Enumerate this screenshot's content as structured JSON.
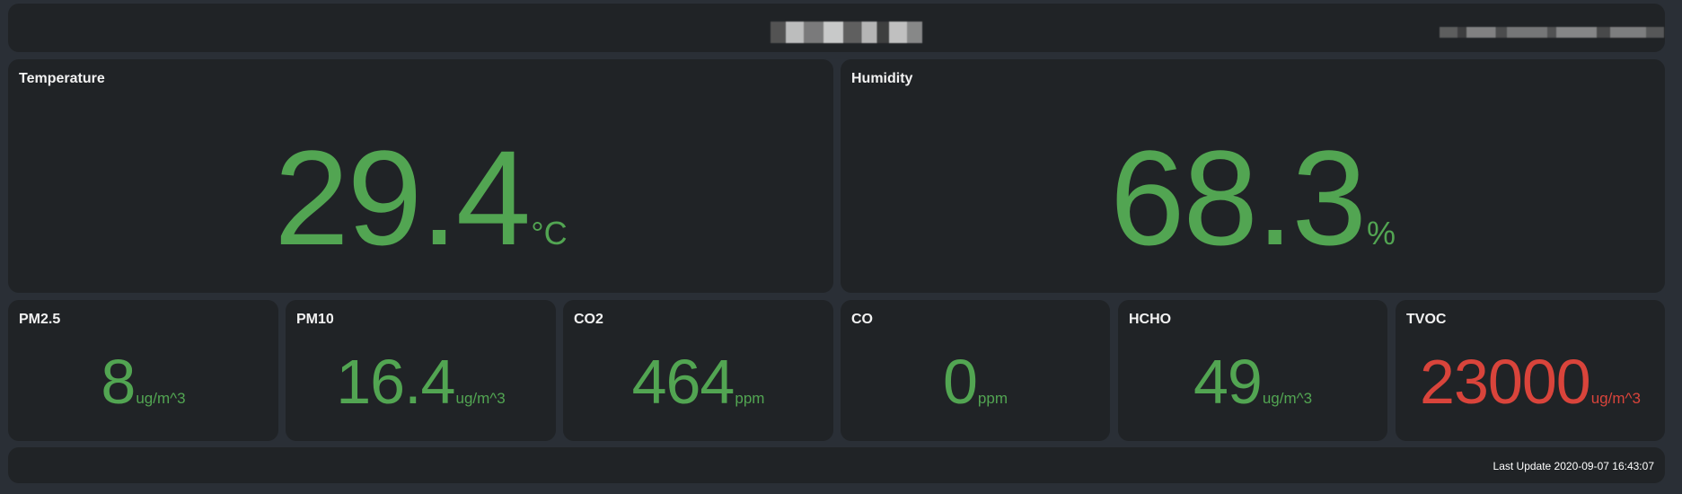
{
  "colors": {
    "background": "#2a2f36",
    "panel": "#202326",
    "ok": "#52a552",
    "alert": "#d9443b"
  },
  "header": {
    "title": "",
    "subtitle": ""
  },
  "sensors": {
    "temperature": {
      "label": "Temperature",
      "value": "29.4",
      "unit": "°C"
    },
    "humidity": {
      "label": "Humidity",
      "value": "68.3",
      "unit": "%"
    },
    "pm25": {
      "label": "PM2.5",
      "value": "8",
      "unit": "ug/m^3"
    },
    "pm10": {
      "label": "PM10",
      "value": "16.4",
      "unit": "ug/m^3"
    },
    "co2": {
      "label": "CO2",
      "value": "464",
      "unit": "ppm"
    },
    "co": {
      "label": "CO",
      "value": "0",
      "unit": "ppm"
    },
    "hcho": {
      "label": "HCHO",
      "value": "49",
      "unit": "ug/m^3"
    },
    "tvoc": {
      "label": "TVOC",
      "value": "23000",
      "unit": "ug/m^3",
      "status": "alert"
    }
  },
  "footer": {
    "last_update": "Last Update 2020-09-07 16:43:07"
  }
}
